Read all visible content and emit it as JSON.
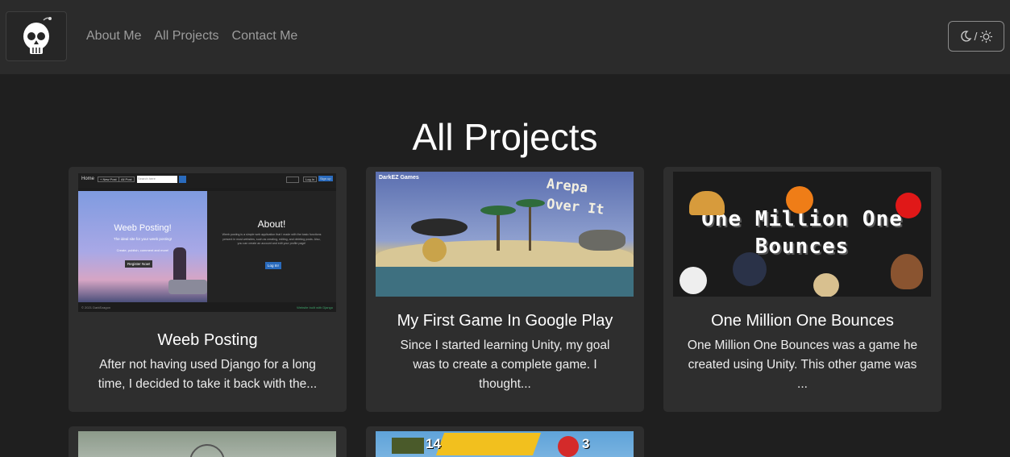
{
  "nav": {
    "links": [
      "About Me",
      "All Projects",
      "Contact Me"
    ],
    "toggle_sep": "/"
  },
  "page": {
    "title": "All Projects"
  },
  "projects": [
    {
      "title": "Weeb Posting",
      "summary": "After not having used Django for a long time, I decided to take it back with the...",
      "thumb": {
        "nav_home": "Home",
        "nav_new_post": "+ New Post",
        "nav_all_post": "All Post",
        "search_placeholder": "Search here",
        "login": "Log In",
        "signup": "Sign up",
        "hero_title": "Weeb Posting!",
        "hero_sub": "The ideal site for your weeb posting!",
        "hero_text": "Create, publish, comment and more!",
        "register_btn": "Register Now!",
        "about_title": "About!",
        "about_text": "Weeb posting is a simple web application that I made with the basic functions present in most websites, such as creating, editing, and deleting posts. Also, you can create an account and edit your profile page!",
        "about_btn": "Log In!",
        "footer_left": "© 2021 DarkEzagon",
        "footer_right": "Website built with Django"
      }
    },
    {
      "title": "My First Game In Google Play",
      "summary": "Since I started learning Unity, my goal was to create a complete game. I thought...",
      "thumb": {
        "studio": "DarkEZ Games",
        "game_title_1": "Arepa",
        "game_title_2": "Over It"
      }
    },
    {
      "title": "One Million One Bounces",
      "summary": "One Million One Bounces was a game he created using Unity. This other game was ...",
      "thumb": {
        "line1": "One Million One",
        "line2": "Bounces"
      }
    },
    {
      "title": "",
      "summary": ""
    },
    {
      "title": "",
      "summary": "",
      "thumb": {
        "score_left": "14",
        "score_right": "3"
      }
    }
  ],
  "colors": {
    "background": "#1f1f1f",
    "navbar": "#2b2b2b",
    "card": "#2e2e2e",
    "nav_link": "#9c9c9c"
  }
}
